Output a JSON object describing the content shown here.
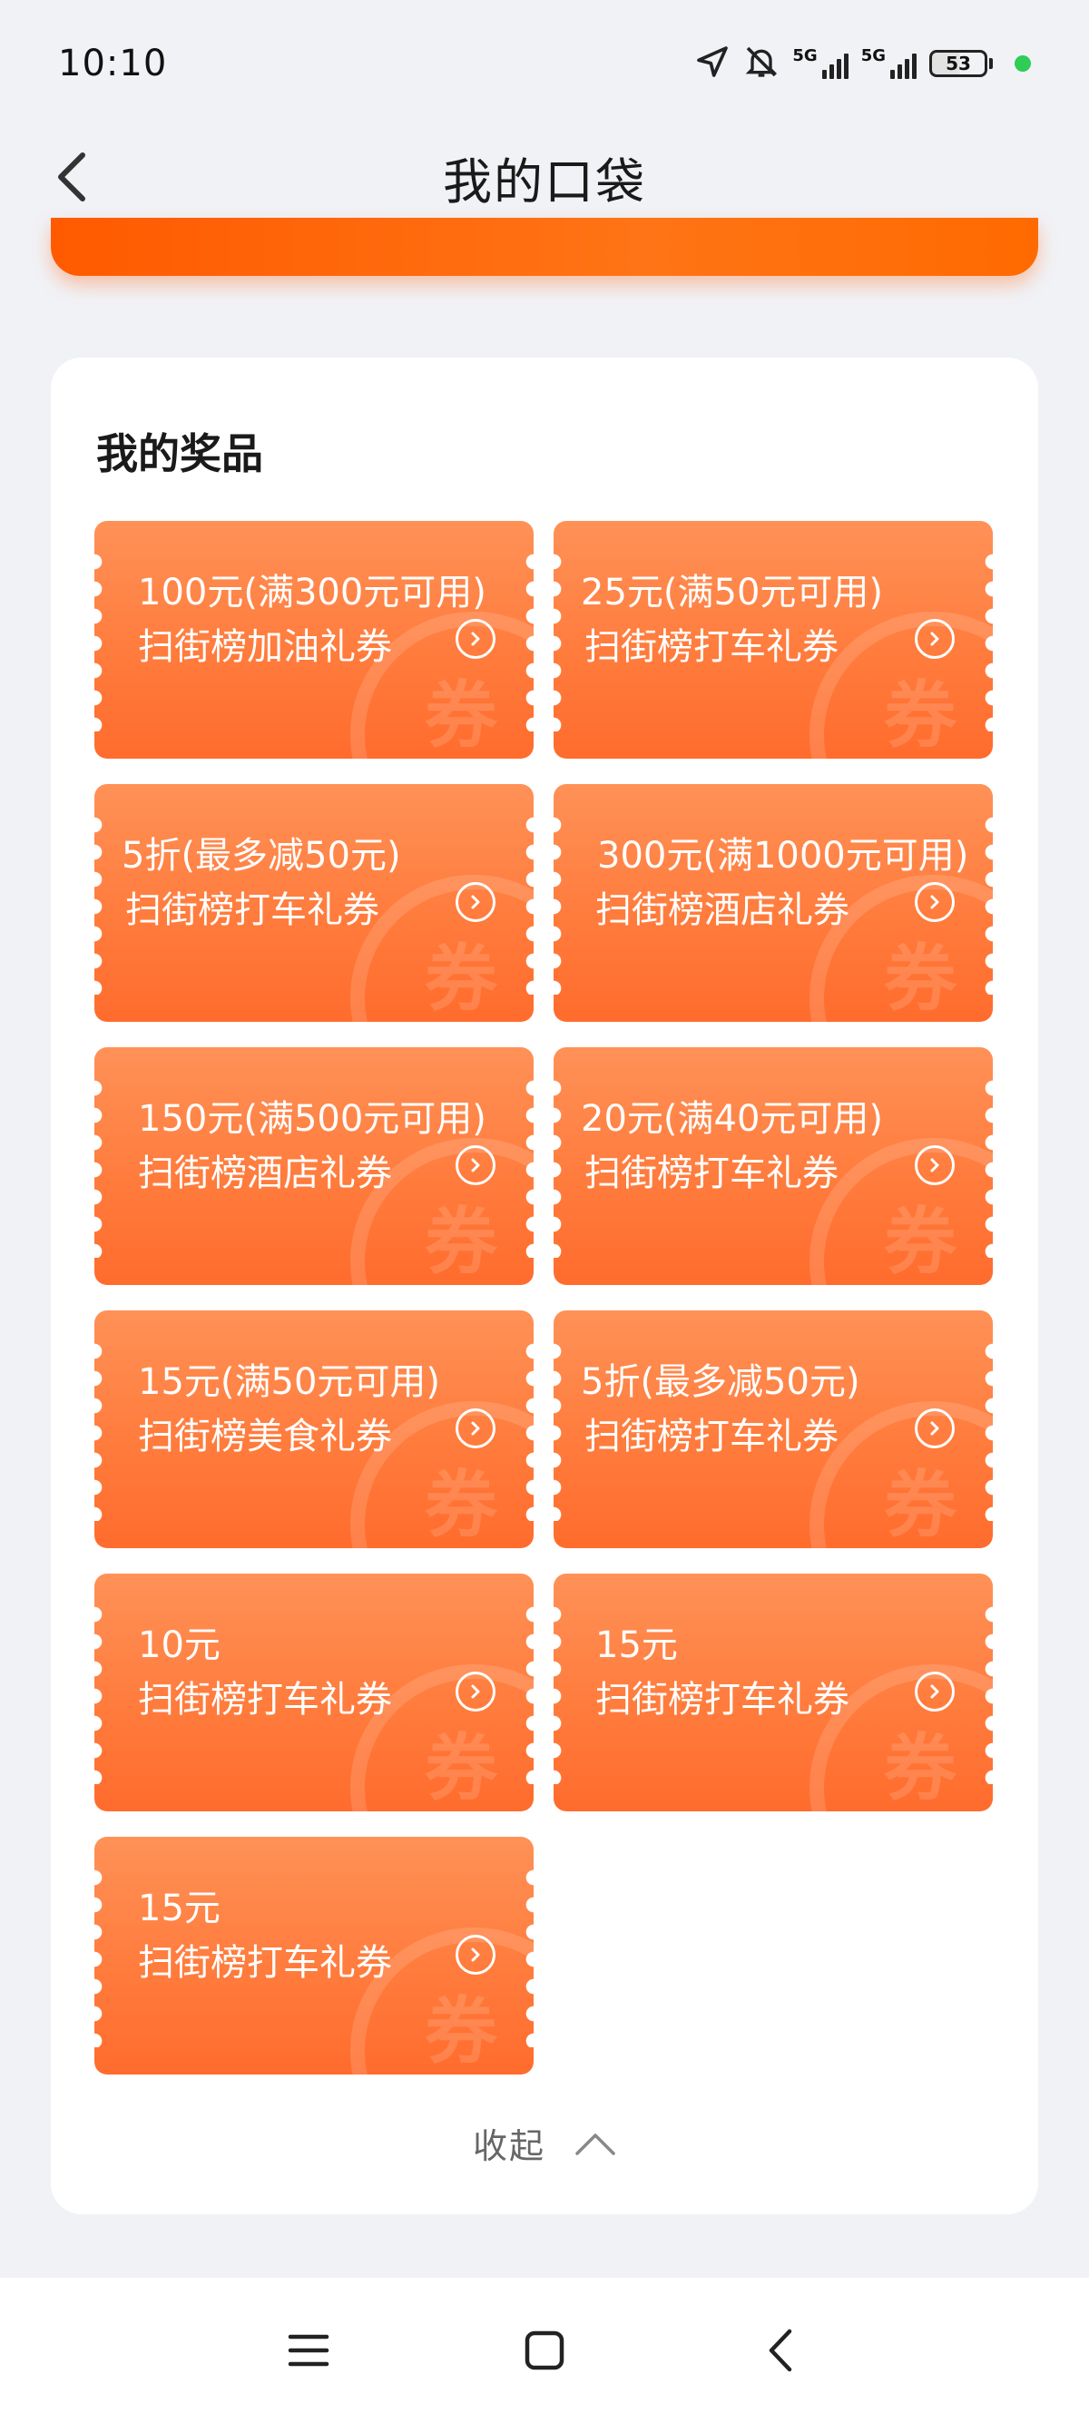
{
  "status_bar": {
    "time": "10:10",
    "network_1": "5G",
    "network_2": "5G",
    "battery_level": "53"
  },
  "header": {
    "title": "我的口袋"
  },
  "prizes": {
    "section_title": "我的奖品",
    "coupons": [
      {
        "amount": "100元(满300元可用)",
        "type": "扫街榜加油礼券"
      },
      {
        "amount": "25元(满50元可用)",
        "type": "扫街榜打车礼券"
      },
      {
        "amount": "5折(最多减50元)",
        "type": "扫街榜打车礼券"
      },
      {
        "amount": "300元(满1000元可用)",
        "type": "扫街榜酒店礼券"
      },
      {
        "amount": "150元(满500元可用)",
        "type": "扫街榜酒店礼券"
      },
      {
        "amount": "20元(满40元可用)",
        "type": "扫街榜打车礼券"
      },
      {
        "amount": "15元(满50元可用)",
        "type": "扫街榜美食礼券"
      },
      {
        "amount": "5折(最多减50元)",
        "type": "扫街榜打车礼券"
      },
      {
        "amount": "10元",
        "type": "扫街榜打车礼券"
      },
      {
        "amount": "15元",
        "type": "扫街榜打车礼券"
      },
      {
        "amount": "15元",
        "type": "扫街榜打车礼券"
      }
    ],
    "coupon_watermark": "券",
    "collapse_label": "收起"
  },
  "colors": {
    "accent": "#ff6a00",
    "coupon_top": "#ff9157",
    "coupon_bottom": "#ff6c2d"
  }
}
